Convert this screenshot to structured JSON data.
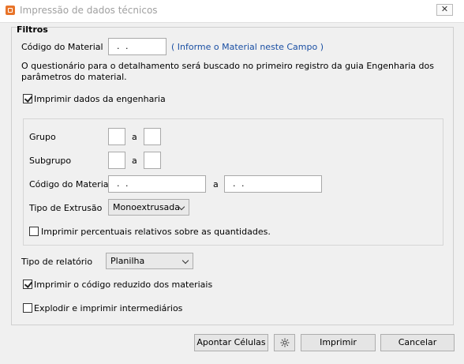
{
  "window": {
    "title": "Impressão de dados técnicos",
    "close_label": "✕"
  },
  "filters": {
    "section_title": "Filtros",
    "material_code_label": "Código do Material",
    "material_code_value": ". .",
    "material_code_hint": "( Informe o Material neste Campo )",
    "info_text": "O questionário para o detalhamento será buscado no primeiro registro da guia Engenharia dos parâmetros do material.",
    "print_engineering_label": "Imprimir dados da engenharia",
    "print_engineering_checked": true
  },
  "group": {
    "grupo_label": "Grupo",
    "subgrupo_label": "Subgrupo",
    "range_sep": "a",
    "material_code_label": "Código do Material",
    "material_from_value": ". .",
    "material_to_value": ". .",
    "extrusion_label": "Tipo de Extrusão",
    "extrusion_value": "Monoextrusada",
    "percent_label": "Imprimir percentuais relativos sobre as quantidades.",
    "percent_checked": false
  },
  "report": {
    "type_label": "Tipo de relatório",
    "type_value": "Planilha",
    "reduced_code_label": "Imprimir o código reduzido dos materiais",
    "reduced_code_checked": true,
    "explode_label": "Explodir e imprimir intermediários",
    "explode_checked": false
  },
  "buttons": {
    "apontar": "Apontar Células",
    "settings_icon": "gear-icon",
    "imprimir": "Imprimir",
    "cancelar": "Cancelar"
  }
}
